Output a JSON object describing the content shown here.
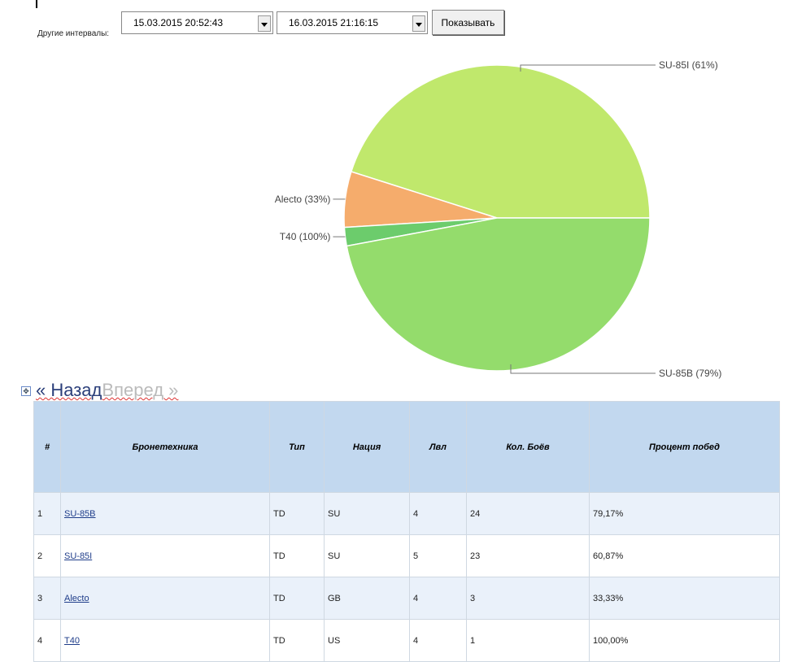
{
  "filters": {
    "label": "Другие интервалы:",
    "from": "15.03.2015 20:52:43",
    "to": "16.03.2015 21:16:15",
    "show_button": "Показывать"
  },
  "colors": {
    "SU-85I": "#c0e86c",
    "Alecto": "#f5ac6c",
    "T40": "#6ccc6c",
    "SU-85B": "#94dc6c"
  },
  "chart_data": {
    "type": "pie",
    "slices": [
      {
        "name": "SU-85I",
        "value": 23,
        "label": "SU-85I (61%)"
      },
      {
        "name": "Alecto",
        "value": 3,
        "label": "Alecto (33%)"
      },
      {
        "name": "T40",
        "value": 1,
        "label": "T40 (100%)"
      },
      {
        "name": "SU-85B",
        "value": 24,
        "label": "SU-85B (79%)"
      }
    ]
  },
  "nav": {
    "back": "« Назад",
    "forward": "Вперед »"
  },
  "table": {
    "headers": [
      "#",
      "Бронетехника",
      "Тип",
      "Нация",
      "Лвл",
      "Кол. Боёв",
      "Процент побед"
    ],
    "rows": [
      [
        "1",
        "SU-85B",
        "TD",
        "SU",
        "4",
        "24",
        "79,17%"
      ],
      [
        "2",
        "SU-85I",
        "TD",
        "SU",
        "5",
        "23",
        "60,87%"
      ],
      [
        "3",
        "Alecto",
        "TD",
        "GB",
        "4",
        "3",
        "33,33%"
      ],
      [
        "4",
        "T40",
        "TD",
        "US",
        "4",
        "1",
        "100,00%"
      ]
    ]
  }
}
